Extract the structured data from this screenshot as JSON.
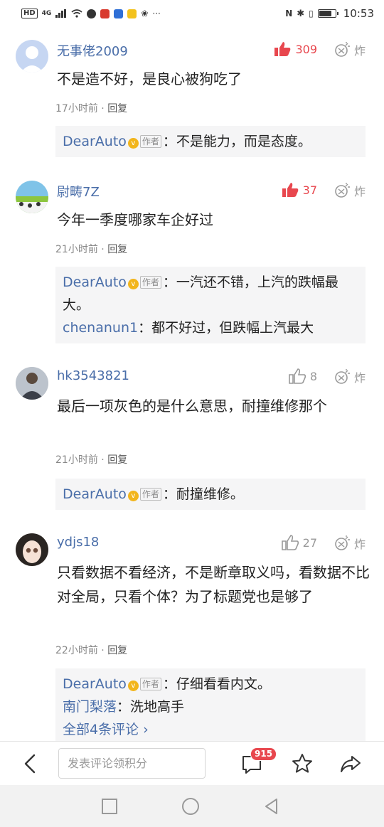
{
  "status_bar": {
    "hd": "HD",
    "network": "4G",
    "time": "10:53",
    "battery_level": 0.8
  },
  "comments": [
    {
      "username": "无事佬2009",
      "likes": "309",
      "hot": true,
      "text": "不是造不好，是良心被狗吃了",
      "time": "17小时前",
      "reply_label": "回复",
      "replies": [
        {
          "user": "DearAuto",
          "author_tag": "作者",
          "sep": "：",
          "text": "不是能力，而是态度。"
        }
      ]
    },
    {
      "username": "尉畴7Z",
      "likes": "37",
      "hot": true,
      "text": "今年一季度哪家车企好过",
      "time": "21小时前",
      "reply_label": "回复",
      "replies": [
        {
          "user": "DearAuto",
          "author_tag": "作者",
          "sep": "：",
          "text": "一汽还不错，上汽的跌幅最大。"
        },
        {
          "user": "chenanun1",
          "sep": "：",
          "text": "都不好过，但跌幅上汽最大"
        }
      ]
    },
    {
      "username": "hk3543821",
      "likes": "8",
      "hot": false,
      "text": "最后一项灰色的是什么意思，耐撞维修那个",
      "time": "21小时前",
      "reply_label": "回复",
      "replies": [
        {
          "user": "DearAuto",
          "author_tag": "作者",
          "sep": "：",
          "text": "耐撞维修。"
        }
      ]
    },
    {
      "username": "ydjs18",
      "likes": "27",
      "hot": false,
      "text": "只看数据不看经济，不是断章取义吗，看数据不比对全局，只看个体？为了标题党也是够了",
      "time": "22小时前",
      "reply_label": "回复",
      "replies": [
        {
          "user": "DearAuto",
          "author_tag": "作者",
          "sep": "：",
          "text": "仔细看看内文。"
        },
        {
          "user": "南门梨落",
          "sep": "：",
          "text": "洗地高手"
        }
      ],
      "more": "全部4条评论 ›"
    }
  ],
  "bottom_bar": {
    "input_placeholder": "发表评论领积分",
    "comment_count": "915"
  },
  "colors": {
    "accent_blue": "#4a6ea9",
    "hot_red": "#e8474e",
    "verified_gold": "#f2b51c"
  }
}
